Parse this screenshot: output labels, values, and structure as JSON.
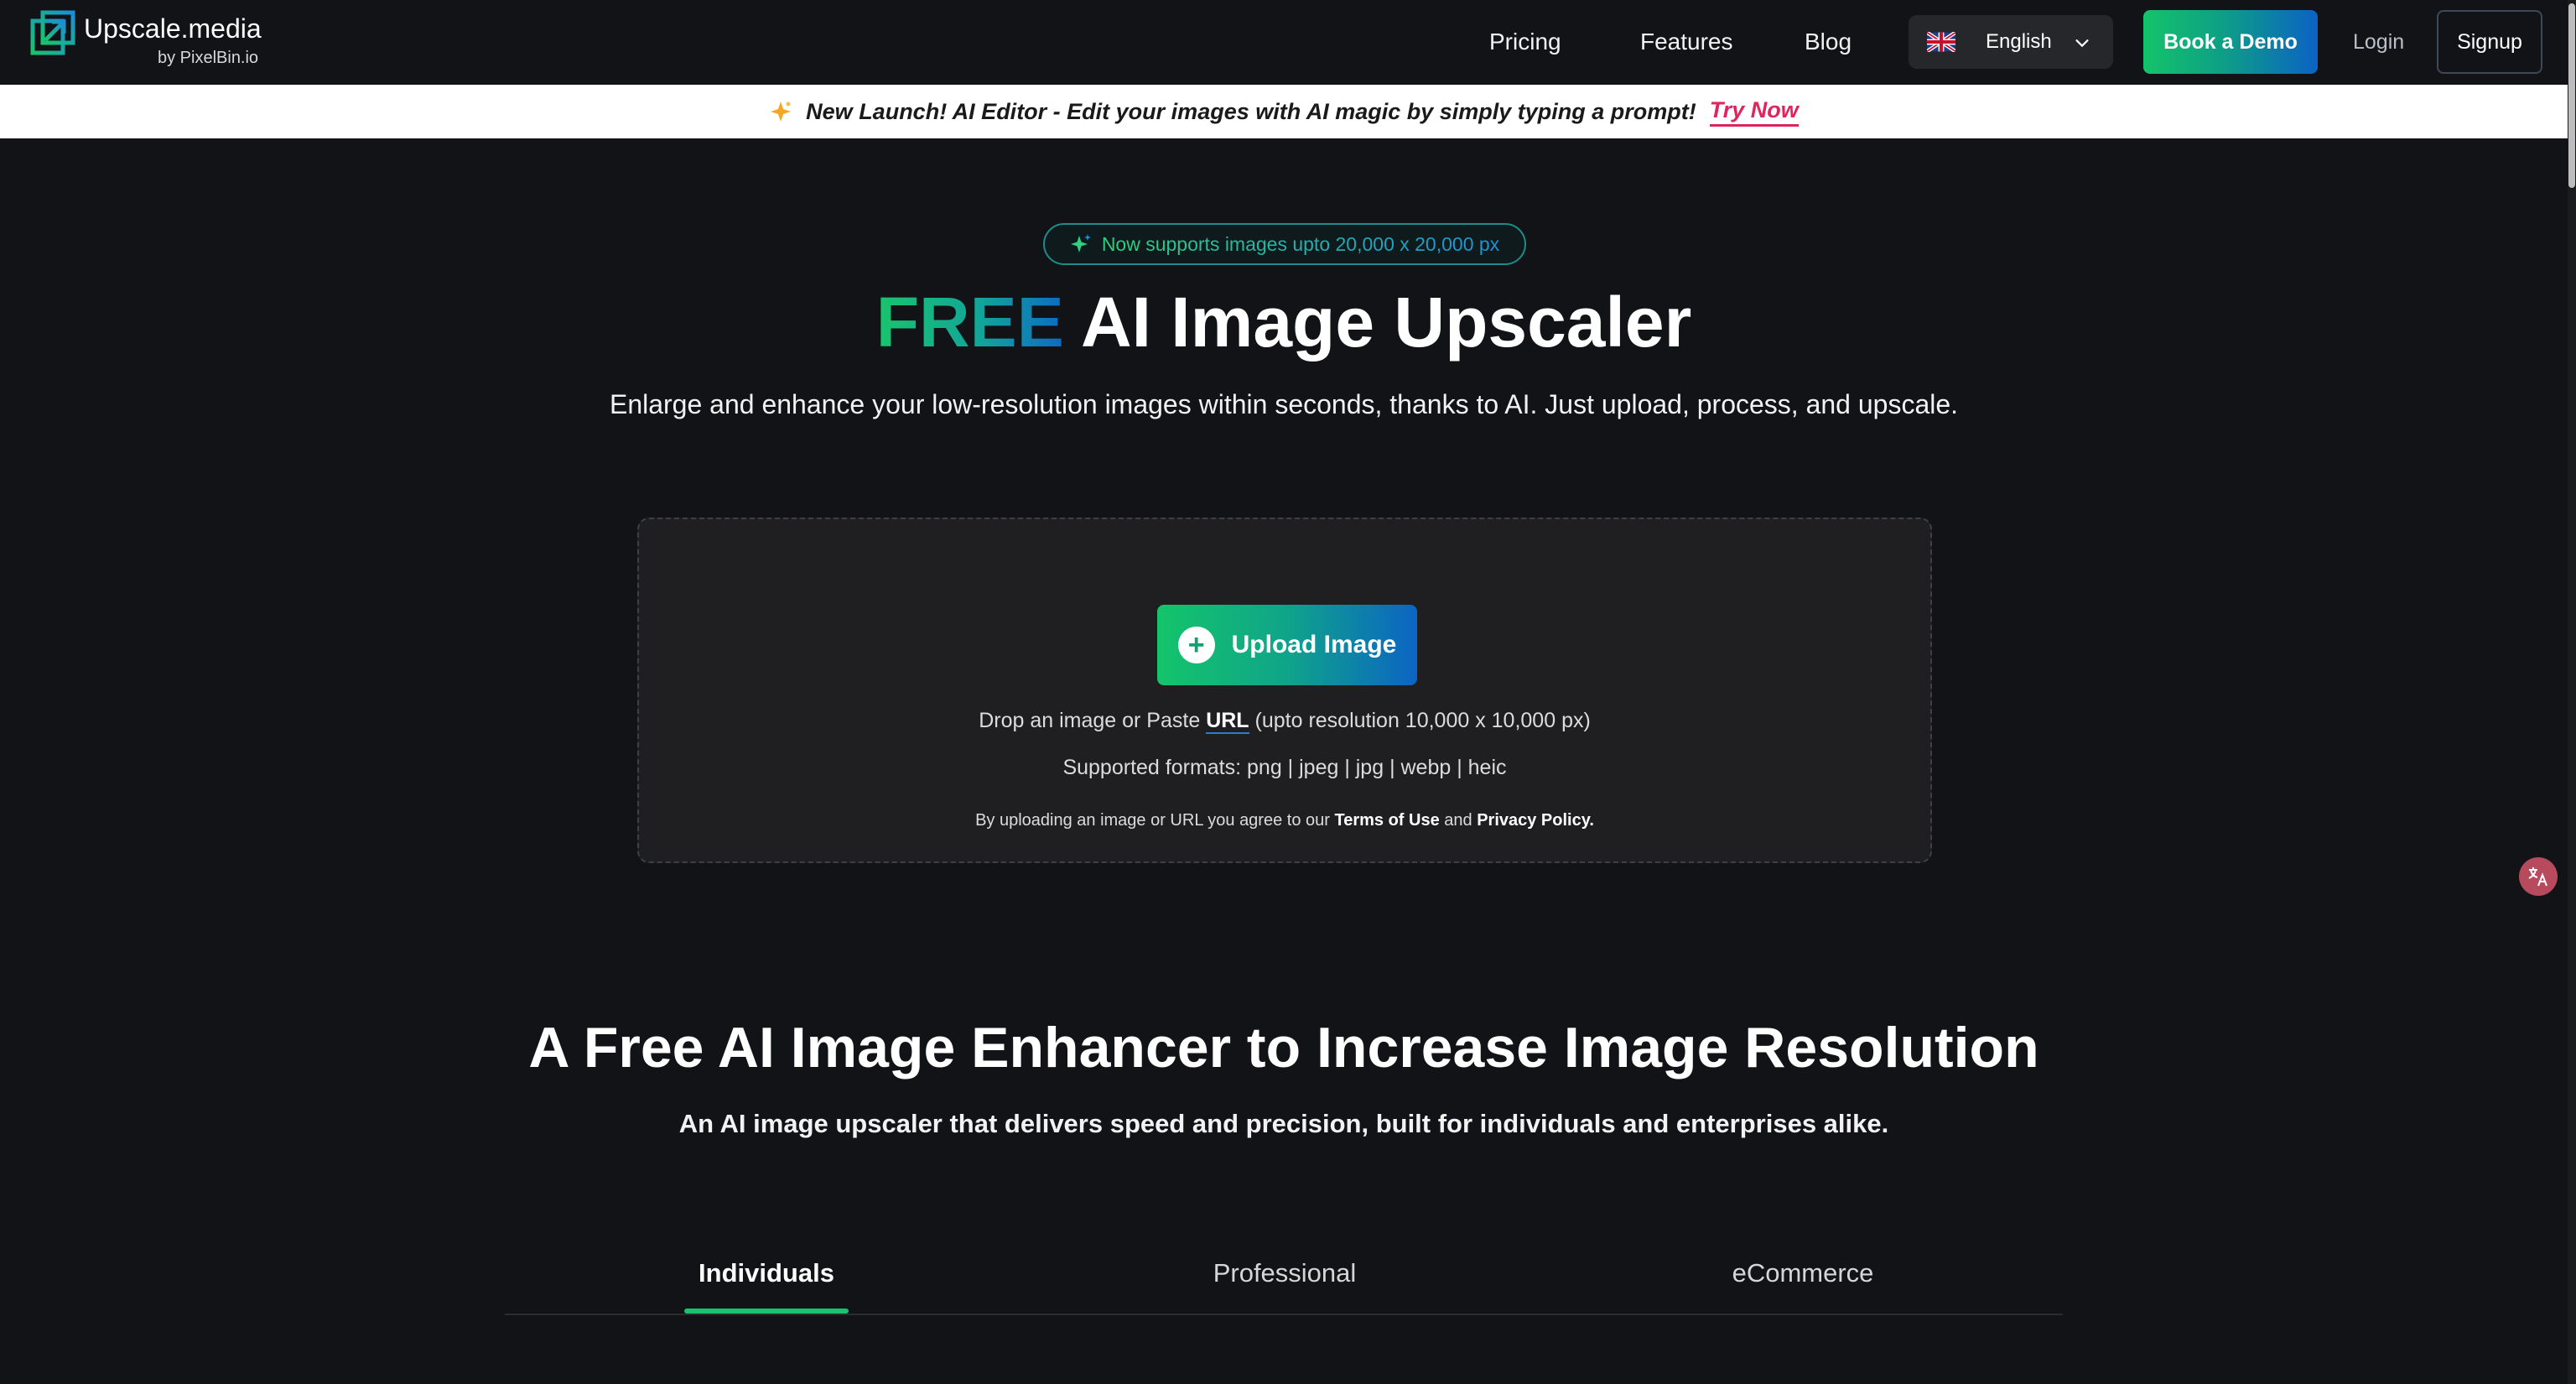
{
  "header": {
    "logo": {
      "name": "Upscale.media",
      "sub": "by PixelBin.io"
    },
    "nav": {
      "pricing": "Pricing",
      "features": "Features",
      "blog": "Blog"
    },
    "language": {
      "selected": "English",
      "flag": "uk-flag-icon"
    },
    "book_demo": "Book a Demo",
    "login": "Login",
    "signup": "Signup"
  },
  "announcement": {
    "text": "New Launch! AI Editor - Edit your images with AI magic by simply typing a prompt!",
    "link": "Try Now",
    "link_color": "#e0245e"
  },
  "hero": {
    "badge": "Now supports images upto 20,000 x 20,000 px",
    "title_highlight": "FREE",
    "title_rest": " AI Image Upscaler",
    "subtitle": "Enlarge and enhance your low-resolution images within seconds, thanks to AI. Just upload, process, and upscale."
  },
  "upload": {
    "button": "Upload Image",
    "drop_prefix": "Drop an image or Paste ",
    "drop_url": "URL",
    "drop_suffix": " (upto resolution 10,000 x 10,000 px)",
    "formats": "Supported formats:  png | jpeg | jpg | webp | heic",
    "terms_prefix": "By uploading an image or URL you agree to our ",
    "terms_link": "Terms of Use",
    "terms_and": " and ",
    "privacy_link": "Privacy Policy."
  },
  "section": {
    "title": "A Free AI Image Enhancer to Increase Image Resolution",
    "subtitle": "An AI image upscaler that delivers speed and precision, built for individuals and enterprises alike.",
    "tabs": [
      {
        "label": "Individuals",
        "active": true
      },
      {
        "label": "Professional",
        "active": false
      },
      {
        "label": "eCommerce",
        "active": false
      }
    ]
  },
  "colors": {
    "background": "#121316",
    "accent_green": "#17c36b",
    "accent_blue": "#0c64c4"
  }
}
